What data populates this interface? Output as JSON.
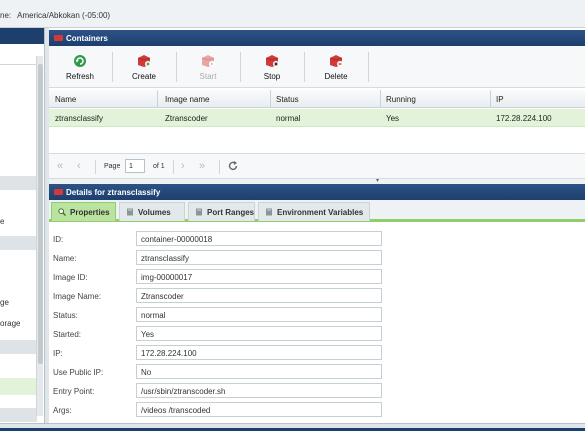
{
  "header": {
    "timezone_label": "ne:",
    "timezone_value": "America/Abkokan (-05:00)"
  },
  "left_nav": {
    "items": [
      "e",
      "ge",
      "orage"
    ]
  },
  "containers": {
    "title": "Containers",
    "toolbar": {
      "refresh": "Refresh",
      "create": "Create",
      "start": "Start",
      "stop": "Stop",
      "delete": "Delete"
    },
    "columns": [
      "Name",
      "Image name",
      "Status",
      "Running",
      "IP"
    ],
    "rows": [
      {
        "name": "ztransclassify",
        "image": "Ztranscoder",
        "status": "normal",
        "running": "Yes",
        "ip": "172.28.224.100"
      }
    ],
    "pager": {
      "page_label": "Page",
      "page_value": "1",
      "of_label": "of 1"
    }
  },
  "details": {
    "title": "Details for ztransclassify",
    "tabs": [
      "Properties",
      "Volumes",
      "Port Ranges",
      "Environment Variables"
    ],
    "active_tab": "Properties",
    "properties": [
      {
        "label": "ID:",
        "value": "container-00000018"
      },
      {
        "label": "Name:",
        "value": "ztransclassify"
      },
      {
        "label": "Image ID:",
        "value": "img-00000017"
      },
      {
        "label": "Image Name:",
        "value": "Ztranscoder"
      },
      {
        "label": "Status:",
        "value": "normal"
      },
      {
        "label": "Started:",
        "value": "Yes"
      },
      {
        "label": "IP:",
        "value": "172.28.224.100"
      },
      {
        "label": "Use Public IP:",
        "value": "No"
      },
      {
        "label": "Entry Point:",
        "value": "/usr/sbin/ztranscoder.sh"
      },
      {
        "label": "Args:",
        "value": "/videos /transcoded"
      }
    ]
  },
  "colors": {
    "header_blue": "#1c3f6e",
    "selection_green": "#e2f3d9",
    "active_tab_green": "#b9e39e",
    "accent_red": "#d23a3a"
  }
}
